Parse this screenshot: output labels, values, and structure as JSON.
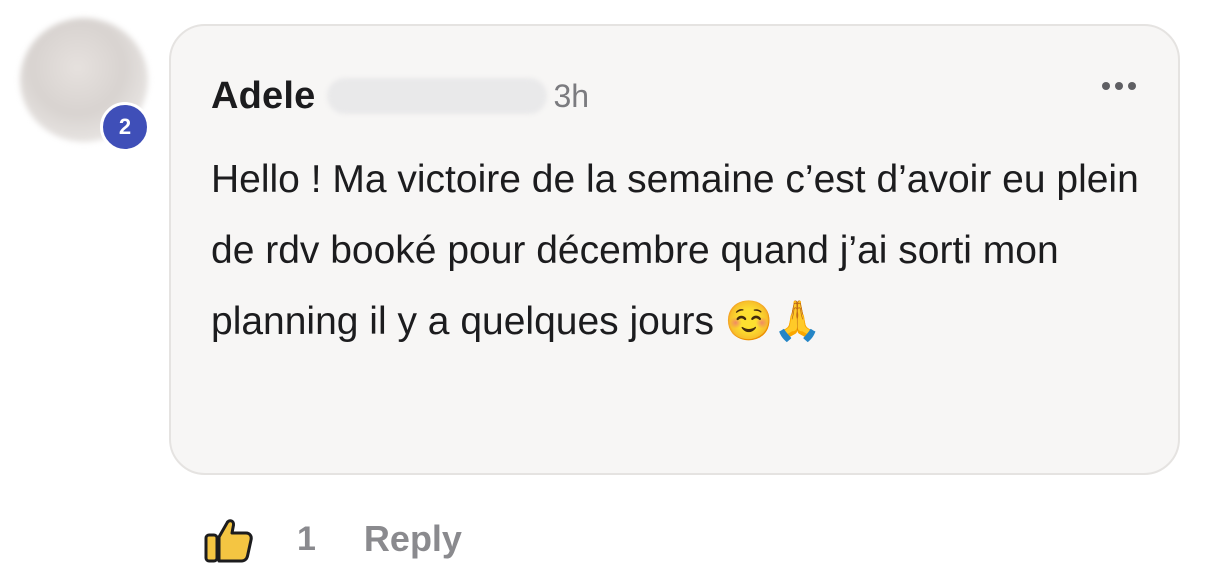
{
  "comment": {
    "author_first_name": "Adele",
    "timestamp": "3h",
    "text": "Hello ! Ma victoire de la semaine c’est d’avoir eu plein de rdv booké pour décembre quand j’ai sorti mon planning il y a quelques jours ☺️🙏",
    "avatar_badge": "2",
    "more_icon": "more-horizontal-icon"
  },
  "actions": {
    "like_icon": "thumbs-up-icon",
    "like_count": "1",
    "reply_label": "Reply"
  },
  "colors": {
    "bubble_background": "#f7f6f5",
    "badge": "#3f4fb8",
    "muted_text": "#8a8a8e"
  }
}
